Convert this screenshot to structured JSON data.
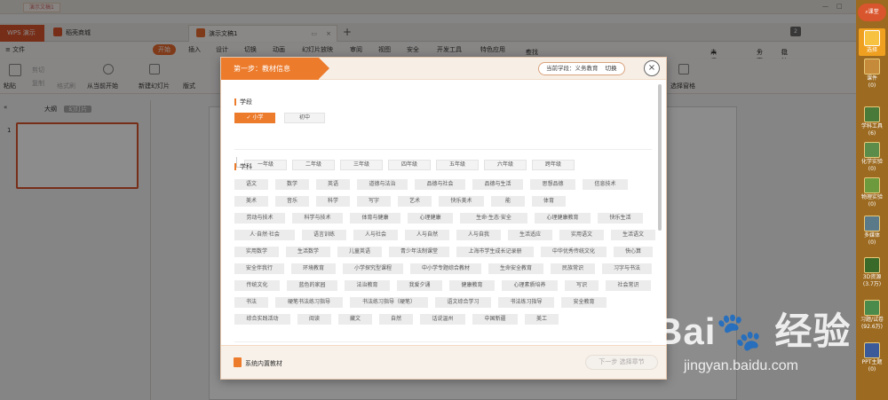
{
  "titlebar": {
    "tab_title": "演示文稿1"
  },
  "tabs": [
    {
      "label": "WPS 演示"
    },
    {
      "label": "稻壳商城"
    },
    {
      "label": "演示文稿1"
    }
  ],
  "tab_count_badge": "2",
  "menu": {
    "file": "≡ 文件",
    "start": "开始",
    "items": [
      "插入",
      "设计",
      "切换",
      "动画",
      "幻灯片放映",
      "审阅",
      "视图",
      "安全",
      "开发工具",
      "特色应用"
    ],
    "search": "查找命令、搜索模板",
    "unsaved": "未保存",
    "share": "分享",
    "comment": "批注"
  },
  "ribbon": {
    "cut": "剪切",
    "copy": "复制",
    "format_painter": "格式刷",
    "paste": "粘贴",
    "from_current": "从当前开始",
    "new_slide": "新建幻灯片",
    "layout": "版式",
    "select_pane": "选择窗格"
  },
  "left_panel": {
    "outline": "大纲",
    "slides": "幻灯片",
    "slide_number": "1"
  },
  "dialog": {
    "step_title": "第一步：教材信息",
    "current_stage": "当前学段：义务教育",
    "switch": "切换",
    "close": "×",
    "stage_section": "学段",
    "stages": [
      "小学",
      "初中"
    ],
    "selected_stage_check": "✓",
    "grades": [
      "一年级",
      "二年级",
      "三年级",
      "四年级",
      "五年级",
      "六年级",
      "跨年级"
    ],
    "subject_section": "学科",
    "subjects": [
      [
        "语文",
        "数学",
        "英语",
        "道德与法治",
        "品德与社会",
        "品德与生活",
        "思想品德",
        "信息技术"
      ],
      [
        "美术",
        "音乐",
        "科学",
        "写字",
        "艺术",
        "快乐美术",
        "能",
        "体育"
      ],
      [
        "劳动与技术",
        "科学与技术",
        "体育与健康",
        "心理健康",
        "生命·生态·安全",
        "心理健康教育",
        "快乐生活"
      ],
      [
        "人·自然·社会",
        "语言训练",
        "人与社会",
        "人与自然",
        "人与自我",
        "生活适应",
        "实用语文",
        "生活语文"
      ],
      [
        "实用数学",
        "生活数学",
        "儿童英语",
        "青少年法制课堂",
        "上海市学生成长记录册",
        "中华优秀传统文化",
        "快心算"
      ],
      [
        "安全伴我行",
        "环境教育",
        "小学探究型课程",
        "中小学专题综合教材",
        "生命安全教育",
        "民族常识",
        "习字与书法"
      ],
      [
        "传统文化",
        "蓝色的家园",
        "法治教育",
        "我爱夕诵",
        "健康教育",
        "心理素质培养",
        "写识",
        "社会常识"
      ],
      [
        "书法",
        "硬笔书法练习指导",
        "书法练习指导（硬笔）",
        "语文综合学习",
        "书法练习指导",
        "安全教育"
      ],
      [
        "综合实践活动",
        "阅读",
        "藏文",
        "自然",
        "话说温州",
        "中国新疆",
        "美工"
      ]
    ],
    "builtin_label": "系统内置教材",
    "next_button": "下一步 选择章节"
  },
  "sidebar": {
    "top_label": "课堂",
    "items": [
      {
        "label": "选择",
        "count": ""
      },
      {
        "label": "课件",
        "count": "(0)"
      },
      {
        "label": "学科工具",
        "count": "(6)"
      },
      {
        "label": "化学实验",
        "count": "(0)"
      },
      {
        "label": "物理实验",
        "count": "(0)"
      },
      {
        "label": "多媒体",
        "count": "(0)"
      },
      {
        "label": "3D资源",
        "count": "(3.7万)"
      },
      {
        "label": "习题/试卷",
        "count": "(92.6万)"
      },
      {
        "label": "PPT主题",
        "count": "(0)"
      }
    ]
  },
  "watermark": {
    "text": "Bai 经验",
    "url": "jingyan.baidu.com"
  }
}
